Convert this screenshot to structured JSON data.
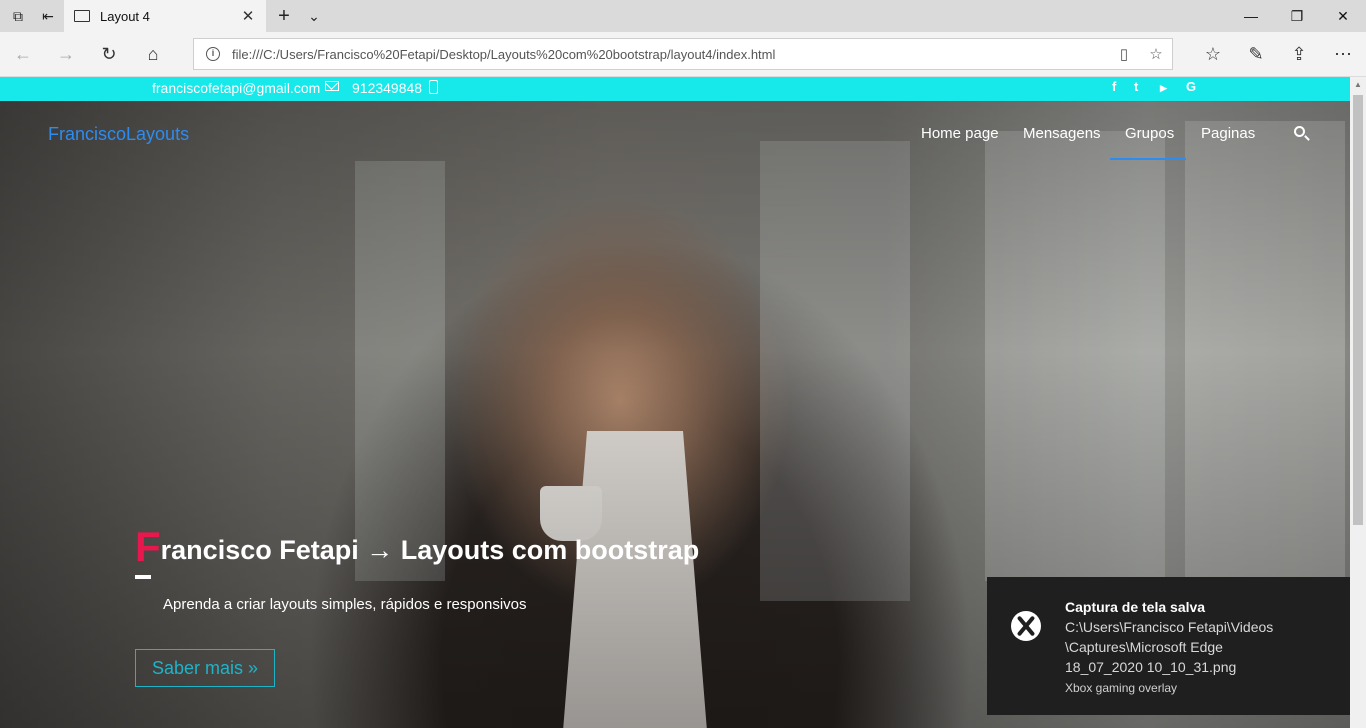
{
  "browser": {
    "tab_title": "Layout 4",
    "url": "file:///C:/Users/Francisco%20Fetapi/Desktop/Layouts%20com%20bootstrap/layout4/index.html"
  },
  "topbar": {
    "email": "franciscofetapi@gmail.com",
    "phone": "912349848",
    "social": [
      {
        "icon": "facebook-icon",
        "glyph": "f"
      },
      {
        "icon": "twitter-icon",
        "glyph": "t"
      },
      {
        "icon": "youtube-icon",
        "glyph": "▶"
      },
      {
        "icon": "google-icon",
        "glyph": "G"
      }
    ],
    "accent": "#17e8ea"
  },
  "site_nav": {
    "brand": "FranciscoLayouts",
    "links": [
      "Home page",
      "Mensagens",
      "Grupos",
      "Paginas"
    ],
    "active": "Grupos",
    "accent": "#2d8cf0"
  },
  "hero": {
    "heading_first_letter": "F",
    "heading_rest": "rancisco Fetapi → Layouts com bootstrap",
    "subtitle": "Aprenda a criar layouts simples, rápidos e responsivos",
    "cta": "Saber mais »",
    "highlight_color": "#e8174d"
  },
  "toast": {
    "title": "Captura de tela salva",
    "lines": [
      "C:\\Users\\Francisco Fetapi\\Videos",
      "\\Captures\\Microsoft Edge",
      "18_07_2020 10_10_31.png"
    ],
    "source": "Xbox gaming overlay"
  }
}
